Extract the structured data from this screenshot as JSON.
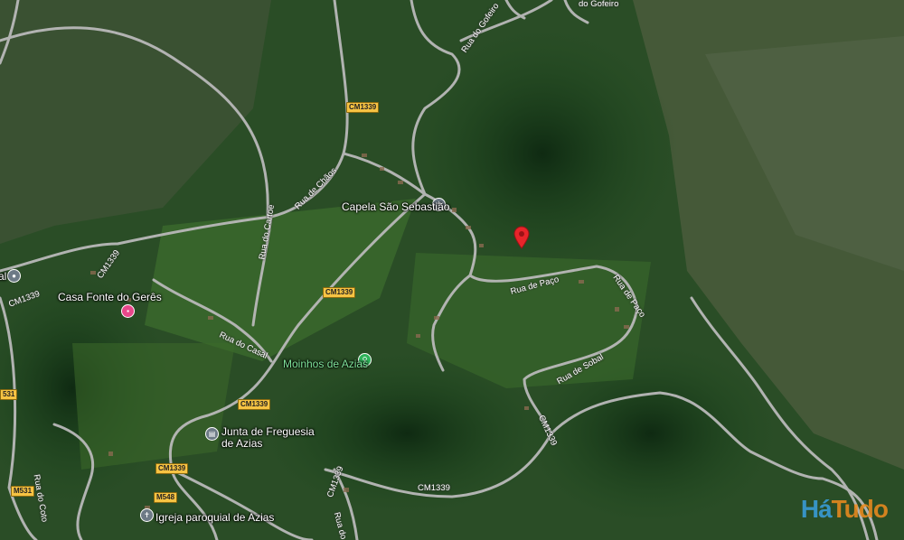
{
  "places": {
    "capela": "Capela São Sebastião",
    "casa_fonte": "Casa Fonte do Gerês",
    "moinhos": "Moinhos de Azias",
    "junta_line1": "Junta de Freguesia",
    "junta_line2": "de Azias",
    "igreja": "Igreja paroquial de Azias",
    "cut_left": "al"
  },
  "streets": {
    "gofeiro_top": "do Gofeiro",
    "gofeiro": "Rua do Gofeiro",
    "chaos": "Rua de Chãos",
    "cartoe": "Rua do Cartoe",
    "casal": "Rua do Casal",
    "paco": "Rua de Paço",
    "paco2": "Rua de Paço",
    "sobal": "Rua de Sobal",
    "coto": "Rua do Coto",
    "mo": "Rua do Mo"
  },
  "shields": {
    "cm1339_a": "CM1339",
    "cm1339_b": "CM1339",
    "cm1339_c": "CM1339",
    "cm1339_d": "CM1339",
    "cm1339_e": "CM1339",
    "cm1339_f": "CM1339",
    "cm1339_g": "CM1339",
    "m548": "M548",
    "m531": "M531",
    "n531": "531"
  },
  "icons": {
    "pin": "location-pin-icon",
    "cross": "church-icon",
    "lodging": "lodging-icon",
    "hiking": "hiking-icon",
    "gov": "city-hall-icon"
  },
  "brand": {
    "part1": "Há",
    "part2": "Tudo"
  },
  "colors": {
    "pin": "#e8242a",
    "lodging": "#e8478b",
    "hiking": "#2fb35a",
    "gray_poi": "#6d7a86",
    "road": "#b9b9b9",
    "shield": "#f6c343"
  }
}
